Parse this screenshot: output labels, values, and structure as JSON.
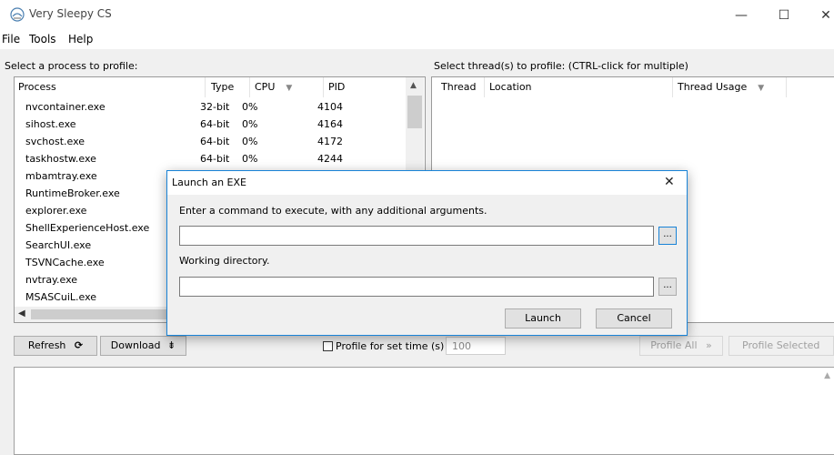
{
  "window": {
    "title": "Very Sleepy CS",
    "minimize": "—",
    "maximize": "☐",
    "close": "✕"
  },
  "menu": [
    "File",
    "Tools",
    "Help"
  ],
  "left_panel": {
    "label": "Select a process to profile:",
    "columns": [
      "Process",
      "Type",
      "CPU",
      "PID"
    ],
    "processes": [
      {
        "name": "nvcontainer.exe",
        "type": "32-bit",
        "cpu": "0%",
        "pid": "4104"
      },
      {
        "name": "sihost.exe",
        "type": "64-bit",
        "cpu": "0%",
        "pid": "4164"
      },
      {
        "name": "svchost.exe",
        "type": "64-bit",
        "cpu": "0%",
        "pid": "4172"
      },
      {
        "name": "taskhostw.exe",
        "type": "64-bit",
        "cpu": "0%",
        "pid": "4244"
      },
      {
        "name": "mbamtray.exe",
        "type": "",
        "cpu": "",
        "pid": ""
      },
      {
        "name": "RuntimeBroker.exe",
        "type": "",
        "cpu": "",
        "pid": ""
      },
      {
        "name": "explorer.exe",
        "type": "",
        "cpu": "",
        "pid": ""
      },
      {
        "name": "ShellExperienceHost.exe",
        "type": "",
        "cpu": "",
        "pid": ""
      },
      {
        "name": "SearchUI.exe",
        "type": "",
        "cpu": "",
        "pid": ""
      },
      {
        "name": "TSVNCache.exe",
        "type": "",
        "cpu": "",
        "pid": ""
      },
      {
        "name": "nvtray.exe",
        "type": "",
        "cpu": "",
        "pid": ""
      },
      {
        "name": "MSASCuiL.exe",
        "type": "",
        "cpu": "",
        "pid": ""
      }
    ]
  },
  "right_panel": {
    "label": "Select thread(s) to profile: (CTRL-click for multiple)",
    "columns": [
      "Thread",
      "Location",
      "Thread Usage"
    ]
  },
  "toolbar": {
    "refresh": "Refresh",
    "download": "Download",
    "profile_time_label": "Profile for set time (s)",
    "profile_time_value": "100",
    "profile_all": "Profile All",
    "profile_selected": "Profile Selected"
  },
  "dialog": {
    "title": "Launch an EXE",
    "command_label": "Enter a command to execute, with any additional arguments.",
    "command_value": "",
    "browse": "...",
    "workdir_label": "Working directory.",
    "workdir_value": "",
    "launch": "Launch",
    "cancel": "Cancel",
    "close": "✕"
  },
  "colors": {
    "accent": "#1883d7",
    "panel": "#f0f0f0"
  }
}
